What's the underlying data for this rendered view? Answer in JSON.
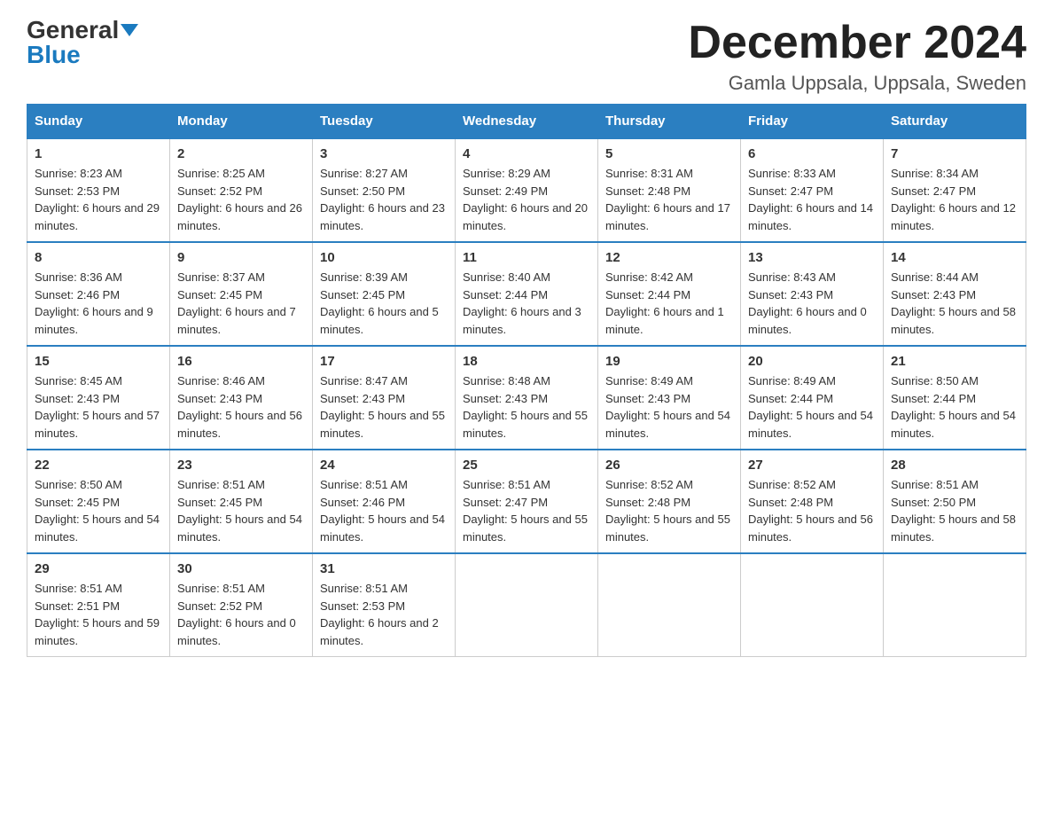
{
  "header": {
    "logo_general": "General",
    "logo_blue": "Blue",
    "month_title": "December 2024",
    "location": "Gamla Uppsala, Uppsala, Sweden"
  },
  "days_of_week": [
    "Sunday",
    "Monday",
    "Tuesday",
    "Wednesday",
    "Thursday",
    "Friday",
    "Saturday"
  ],
  "weeks": [
    [
      {
        "day": "1",
        "sunrise": "8:23 AM",
        "sunset": "2:53 PM",
        "daylight": "6 hours and 29 minutes."
      },
      {
        "day": "2",
        "sunrise": "8:25 AM",
        "sunset": "2:52 PM",
        "daylight": "6 hours and 26 minutes."
      },
      {
        "day": "3",
        "sunrise": "8:27 AM",
        "sunset": "2:50 PM",
        "daylight": "6 hours and 23 minutes."
      },
      {
        "day": "4",
        "sunrise": "8:29 AM",
        "sunset": "2:49 PM",
        "daylight": "6 hours and 20 minutes."
      },
      {
        "day": "5",
        "sunrise": "8:31 AM",
        "sunset": "2:48 PM",
        "daylight": "6 hours and 17 minutes."
      },
      {
        "day": "6",
        "sunrise": "8:33 AM",
        "sunset": "2:47 PM",
        "daylight": "6 hours and 14 minutes."
      },
      {
        "day": "7",
        "sunrise": "8:34 AM",
        "sunset": "2:47 PM",
        "daylight": "6 hours and 12 minutes."
      }
    ],
    [
      {
        "day": "8",
        "sunrise": "8:36 AM",
        "sunset": "2:46 PM",
        "daylight": "6 hours and 9 minutes."
      },
      {
        "day": "9",
        "sunrise": "8:37 AM",
        "sunset": "2:45 PM",
        "daylight": "6 hours and 7 minutes."
      },
      {
        "day": "10",
        "sunrise": "8:39 AM",
        "sunset": "2:45 PM",
        "daylight": "6 hours and 5 minutes."
      },
      {
        "day": "11",
        "sunrise": "8:40 AM",
        "sunset": "2:44 PM",
        "daylight": "6 hours and 3 minutes."
      },
      {
        "day": "12",
        "sunrise": "8:42 AM",
        "sunset": "2:44 PM",
        "daylight": "6 hours and 1 minute."
      },
      {
        "day": "13",
        "sunrise": "8:43 AM",
        "sunset": "2:43 PM",
        "daylight": "6 hours and 0 minutes."
      },
      {
        "day": "14",
        "sunrise": "8:44 AM",
        "sunset": "2:43 PM",
        "daylight": "5 hours and 58 minutes."
      }
    ],
    [
      {
        "day": "15",
        "sunrise": "8:45 AM",
        "sunset": "2:43 PM",
        "daylight": "5 hours and 57 minutes."
      },
      {
        "day": "16",
        "sunrise": "8:46 AM",
        "sunset": "2:43 PM",
        "daylight": "5 hours and 56 minutes."
      },
      {
        "day": "17",
        "sunrise": "8:47 AM",
        "sunset": "2:43 PM",
        "daylight": "5 hours and 55 minutes."
      },
      {
        "day": "18",
        "sunrise": "8:48 AM",
        "sunset": "2:43 PM",
        "daylight": "5 hours and 55 minutes."
      },
      {
        "day": "19",
        "sunrise": "8:49 AM",
        "sunset": "2:43 PM",
        "daylight": "5 hours and 54 minutes."
      },
      {
        "day": "20",
        "sunrise": "8:49 AM",
        "sunset": "2:44 PM",
        "daylight": "5 hours and 54 minutes."
      },
      {
        "day": "21",
        "sunrise": "8:50 AM",
        "sunset": "2:44 PM",
        "daylight": "5 hours and 54 minutes."
      }
    ],
    [
      {
        "day": "22",
        "sunrise": "8:50 AM",
        "sunset": "2:45 PM",
        "daylight": "5 hours and 54 minutes."
      },
      {
        "day": "23",
        "sunrise": "8:51 AM",
        "sunset": "2:45 PM",
        "daylight": "5 hours and 54 minutes."
      },
      {
        "day": "24",
        "sunrise": "8:51 AM",
        "sunset": "2:46 PM",
        "daylight": "5 hours and 54 minutes."
      },
      {
        "day": "25",
        "sunrise": "8:51 AM",
        "sunset": "2:47 PM",
        "daylight": "5 hours and 55 minutes."
      },
      {
        "day": "26",
        "sunrise": "8:52 AM",
        "sunset": "2:48 PM",
        "daylight": "5 hours and 55 minutes."
      },
      {
        "day": "27",
        "sunrise": "8:52 AM",
        "sunset": "2:48 PM",
        "daylight": "5 hours and 56 minutes."
      },
      {
        "day": "28",
        "sunrise": "8:51 AM",
        "sunset": "2:50 PM",
        "daylight": "5 hours and 58 minutes."
      }
    ],
    [
      {
        "day": "29",
        "sunrise": "8:51 AM",
        "sunset": "2:51 PM",
        "daylight": "5 hours and 59 minutes."
      },
      {
        "day": "30",
        "sunrise": "8:51 AM",
        "sunset": "2:52 PM",
        "daylight": "6 hours and 0 minutes."
      },
      {
        "day": "31",
        "sunrise": "8:51 AM",
        "sunset": "2:53 PM",
        "daylight": "6 hours and 2 minutes."
      },
      null,
      null,
      null,
      null
    ]
  ],
  "labels": {
    "sunrise": "Sunrise:",
    "sunset": "Sunset:",
    "daylight": "Daylight:"
  }
}
